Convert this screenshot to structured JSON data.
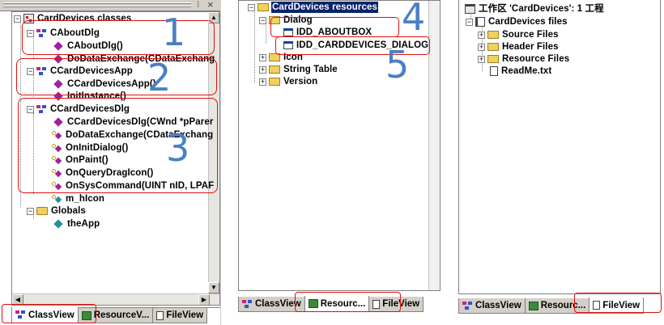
{
  "panel1": {
    "title_left": "⁝",
    "title_close": "×",
    "root": "CardDevices classes",
    "classes": [
      {
        "name": "CAboutDlg",
        "members": [
          "CAboutDlg()",
          "DoDataExchange(CDataExchang"
        ]
      },
      {
        "name": "CCardDevicesApp",
        "members": [
          "CCardDevicesApp()",
          "InitInstance()"
        ]
      },
      {
        "name": "CCardDevicesDlg",
        "members": [
          "CCardDevicesDlg(CWnd *pParer",
          "DoDataExchange(CDataExchang",
          "OnInitDialog()",
          "OnPaint()",
          "OnQueryDragIcon()",
          "OnSysCommand(UINT nID, LPAF",
          "m_hIcon"
        ]
      }
    ],
    "globals": "Globals",
    "global_items": [
      "theApp"
    ],
    "tabs": [
      "ClassView",
      "ResourceV...",
      "FileView"
    ]
  },
  "panel2": {
    "root": "CardDevices resources",
    "folders": [
      "Dialog",
      "Icon",
      "String Table",
      "Version"
    ],
    "dialogs": [
      "IDD_ABOUTBOX",
      "IDD_CARDDEVICES_DIALOG"
    ],
    "tabs": [
      "ClassView",
      "Resourc...",
      "FileView"
    ]
  },
  "panel3": {
    "root": "工作区 'CardDevices': 1 工程",
    "project": "CardDevices files",
    "folders": [
      "Source Files",
      "Header Files",
      "Resource Files"
    ],
    "file": "ReadMe.txt",
    "tabs": [
      "ClassView",
      "Resourc...",
      "FileView"
    ]
  },
  "annotations": [
    "1",
    "2",
    "3",
    "4",
    "5"
  ],
  "colors": {
    "annotation_box": "#e01010",
    "annotation_number": "#4a7fc4",
    "selection": "#0a246a",
    "method_icon": "#a020a0",
    "class_icon": "#3050d0",
    "field_icon": "#2090a0",
    "folder_icon": "#f0d060"
  }
}
